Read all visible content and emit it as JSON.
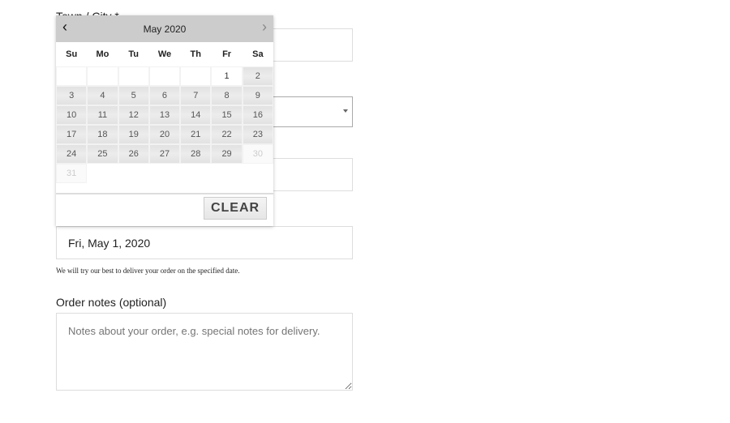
{
  "form": {
    "town_label": "Town / City *",
    "date_value": "Fri, May 1, 2020",
    "date_hint": "We will try our best to deliver your order on the specified date.",
    "notes_label": "Order notes (optional)",
    "notes_placeholder": "Notes about your order, e.g. special notes for delivery."
  },
  "calendar": {
    "month_label": "May 2020",
    "prev_icon": "chevron-left-icon",
    "next_icon": "chevron-right-icon",
    "weekdays": [
      "Su",
      "Mo",
      "Tu",
      "We",
      "Th",
      "Fr",
      "Sa"
    ],
    "selected_day": 1,
    "clear_label": "CLEAR"
  }
}
